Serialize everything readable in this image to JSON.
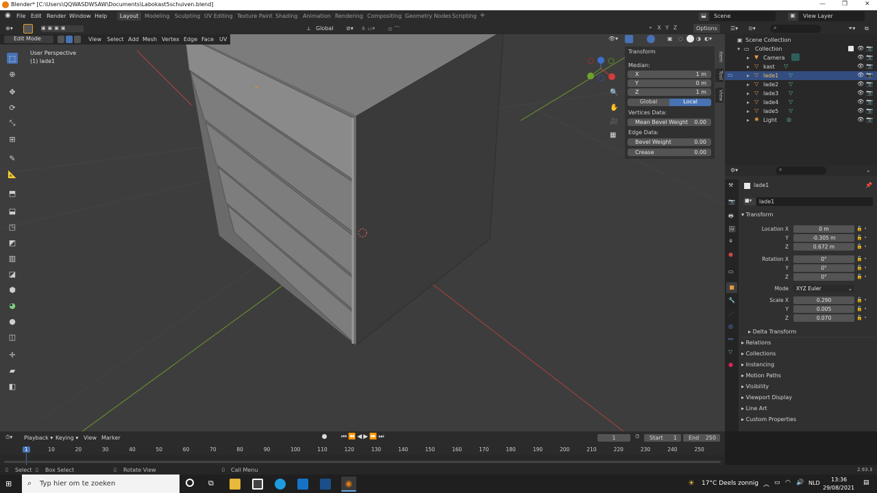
{
  "title": "Blender* [C:\\Users\\QQWASDWSAW\\Documents\\Labokast5schuiven.blend]",
  "menus": [
    "File",
    "Edit",
    "Render",
    "Window",
    "Help"
  ],
  "workspaces": [
    "Layout",
    "Modeling",
    "Sculpting",
    "UV Editing",
    "Texture Paint",
    "Shading",
    "Animation",
    "Rendering",
    "Compositing",
    "Geometry Nodes",
    "Scripting"
  ],
  "active_workspace": "Layout",
  "scene": "Scene",
  "view_layer": "View Layer",
  "header": {
    "mode": "Edit Mode",
    "menus": [
      "View",
      "Select",
      "Add",
      "Mesh",
      "Vertex",
      "Edge",
      "Face",
      "UV"
    ],
    "orientation": "Global",
    "options": "Options"
  },
  "viewport": {
    "perspective": "User Perspective",
    "object": "(1) lade1"
  },
  "npanel": {
    "title": "Transform",
    "median": "Median:",
    "x_label": "X",
    "x_value": "1 m",
    "y_label": "Y",
    "y_value": "0 m",
    "z_label": "Z",
    "z_value": "1 m",
    "global": "Global",
    "local": "Local",
    "vertices_data": "Vertices Data:",
    "mean_bevel_label": "Mean Bevel Weight",
    "mean_bevel_value": "0.00",
    "edge_data": "Edge Data:",
    "bevel_label": "Bevel Weight",
    "bevel_value": "0.00",
    "crease_label": "Crease",
    "crease_value": "0.00",
    "tabs": [
      "Item",
      "Tool",
      "View"
    ]
  },
  "outliner": {
    "root": "Scene Collection",
    "collection": "Collection",
    "items": [
      "Camera",
      "kast",
      "lade1",
      "lade2",
      "lade3",
      "lade4",
      "lade5",
      "Light"
    ],
    "selected": "lade1"
  },
  "properties": {
    "object_name": "lade1",
    "data_name": "lade1",
    "transform": "Transform",
    "location_label": "Location X",
    "loc_x": "0 m",
    "loc_y": "-0.305 m",
    "loc_z": "0.672 m",
    "rotation_label": "Rotation X",
    "rot_x": "0°",
    "rot_y": "0°",
    "rot_z": "0°",
    "mode_label": "Mode",
    "mode_value": "XYZ Euler",
    "scale_label": "Scale X",
    "scale_x": "0.290",
    "scale_y": "0.005",
    "scale_z": "0.070",
    "y": "Y",
    "z": "Z",
    "delta": "Delta Transform",
    "sections": [
      "Relations",
      "Collections",
      "Instancing",
      "Motion Paths",
      "Visibility",
      "Viewport Display",
      "Line Art",
      "Custom Properties"
    ]
  },
  "timeline": {
    "menus": [
      "Playback",
      "Keying",
      "View",
      "Marker"
    ],
    "current_frame": "1",
    "start_label": "Start",
    "start": "1",
    "end_label": "End",
    "end": "250",
    "ticks": [
      "1",
      "10",
      "20",
      "30",
      "40",
      "50",
      "60",
      "70",
      "80",
      "90",
      "100",
      "110",
      "120",
      "130",
      "140",
      "150",
      "160",
      "170",
      "180",
      "190",
      "200",
      "210",
      "220",
      "230",
      "240",
      "250"
    ]
  },
  "status": {
    "select": "Select",
    "box_select": "Box Select",
    "rotate_view": "Rotate View",
    "call_menu": "Call Menu",
    "version": "2.93.3"
  },
  "taskbar": {
    "search": "Typ hier om te zoeken",
    "weather": "17°C  Deels zonnig",
    "lang": "NLD",
    "time": "13:36",
    "date": "29/08/2021"
  },
  "colors": {
    "accent": "#4772b3",
    "outliner_selected": "#334d80",
    "x_axis": "#c04040",
    "y_axis": "#7aa830"
  }
}
